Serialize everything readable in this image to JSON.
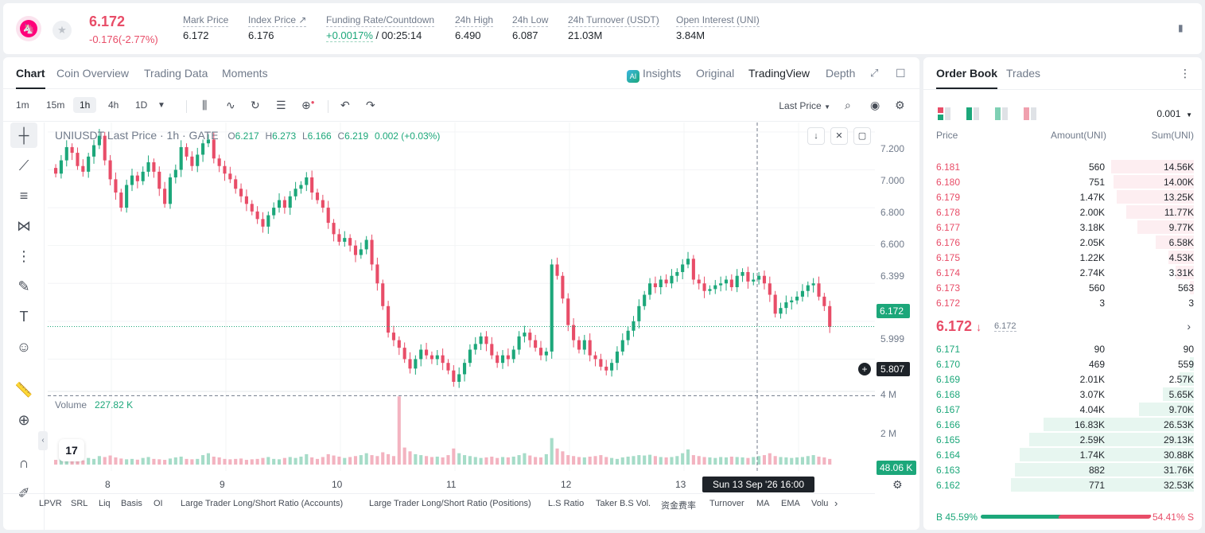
{
  "header": {
    "last_price": "6.172",
    "change": "-0.176(-2.77%)",
    "stats": [
      {
        "label": "Mark Price",
        "value": "6.172"
      },
      {
        "label": "Index Price ↗",
        "value": "6.176"
      },
      {
        "label": "Funding Rate/Countdown",
        "rate": "+0.0017%",
        "countdown": "/ 00:25:14"
      },
      {
        "label": "24h High",
        "value": "6.490"
      },
      {
        "label": "24h Low",
        "value": "6.087"
      },
      {
        "label": "24h Turnover (USDT)",
        "value": "21.03M"
      },
      {
        "label": "Open Interest (UNI)",
        "value": "3.84M"
      }
    ]
  },
  "tabs": {
    "chart": "Chart",
    "coin_overview": "Coin Overview",
    "trading_data": "Trading Data",
    "moments": "Moments",
    "ai_badge": "AI",
    "insights": "Insights",
    "original": "Original",
    "tradingview": "TradingView",
    "depth": "Depth"
  },
  "toolbar": {
    "timeframes": [
      "1m",
      "15m",
      "1h",
      "4h",
      "1D"
    ],
    "active_timeframe": "1h",
    "price_type": "Last Price"
  },
  "legend": {
    "symbol": "UNIUSDT Last Price · 1h · GATE",
    "o_label": "O",
    "o": "6.217",
    "h_label": "H",
    "h": "6.273",
    "l_label": "L",
    "l": "6.166",
    "c_label": "C",
    "c": "6.219",
    "chg": "0.002 (+0.03%)",
    "volume_label": "Volume",
    "volume_value": "227.82 K"
  },
  "price_axis": [
    "7.200",
    "7.000",
    "6.800",
    "6.600",
    "6.399",
    "5.999",
    "4 M",
    "2 M"
  ],
  "tags": {
    "current_price": "6.172",
    "crosshair_price": "5.807",
    "volume": "48.06 K",
    "date": "Sun 13 Sep '26   16:00"
  },
  "x_axis": [
    "8",
    "9",
    "10",
    "11",
    "12",
    "13"
  ],
  "indicators": [
    "LPVR",
    "SRL",
    "Liq",
    "Basis",
    "OI",
    "Large Trader Long/Short Ratio (Accounts)",
    "Large Trader Long/Short Ratio (Positions)",
    "L.S Ratio",
    "Taker B.S Vol.",
    "资金费率",
    "Turnover",
    "MA",
    "EMA",
    "Volu"
  ],
  "chart_data": {
    "type": "candlestick",
    "symbol": "UNIUSDT",
    "interval": "1h",
    "ylim": [
      5.8,
      7.25
    ],
    "colors": {
      "up": "#1ca77a",
      "down": "#e84d68"
    },
    "closes": [
      6.98,
      7.05,
      7.12,
      7.09,
      7.02,
      6.99,
      7.07,
      7.13,
      7.18,
      7.05,
      6.95,
      6.88,
      6.8,
      6.92,
      6.97,
      6.94,
      6.99,
      7.04,
      6.99,
      6.9,
      6.82,
      6.96,
      7.0,
      7.12,
      7.07,
      7.02,
      7.08,
      7.14,
      7.16,
      7.06,
      7.02,
      6.98,
      6.95,
      6.9,
      6.86,
      6.82,
      6.78,
      6.74,
      6.7,
      6.76,
      6.8,
      6.84,
      6.8,
      6.86,
      6.9,
      6.92,
      6.96,
      6.88,
      6.84,
      6.8,
      6.72,
      6.66,
      6.62,
      6.64,
      6.6,
      6.55,
      6.58,
      6.63,
      6.5,
      6.4,
      6.28,
      6.14,
      6.1,
      6.06,
      6.0,
      5.95,
      6.0,
      6.05,
      6.02,
      6.0,
      6.02,
      5.98,
      5.94,
      5.88,
      5.92,
      5.98,
      6.05,
      6.08,
      6.12,
      6.08,
      6.02,
      5.98,
      6.02,
      6.0,
      6.05,
      6.12,
      6.14,
      6.1,
      6.06,
      6.02,
      6.04,
      6.5,
      6.44,
      6.32,
      6.18,
      6.1,
      6.05,
      6.1,
      6.02,
      6.0,
      5.96,
      5.94,
      5.98,
      6.04,
      6.1,
      6.15,
      6.2,
      6.28,
      6.34,
      6.4,
      6.38,
      6.42,
      6.4,
      6.44,
      6.46,
      6.5,
      6.53,
      6.42,
      6.4,
      6.36,
      6.37,
      6.39,
      6.4,
      6.42,
      6.38,
      6.44,
      6.46,
      6.41,
      6.42,
      6.44,
      6.4,
      6.34,
      6.24,
      6.27,
      6.3,
      6.31,
      6.33,
      6.36,
      6.39,
      6.4,
      6.33,
      6.28,
      6.17
    ],
    "volumes": [
      0.25,
      0.32,
      0.4,
      0.3,
      0.28,
      0.22,
      0.35,
      0.3,
      0.45,
      0.4,
      0.48,
      0.38,
      0.32,
      0.28,
      0.3,
      0.26,
      0.35,
      0.4,
      0.3,
      0.28,
      0.25,
      0.32,
      0.38,
      0.42,
      0.3,
      0.28,
      0.3,
      0.5,
      0.6,
      0.42,
      0.38,
      0.3,
      0.28,
      0.3,
      0.32,
      0.25,
      0.28,
      0.3,
      0.35,
      0.4,
      0.3,
      0.28,
      0.35,
      0.4,
      0.35,
      0.42,
      0.55,
      0.38,
      0.3,
      0.4,
      0.55,
      0.48,
      0.42,
      0.35,
      0.4,
      0.45,
      0.5,
      0.6,
      0.5,
      0.45,
      0.65,
      0.55,
      0.45,
      3.6,
      0.9,
      0.7,
      0.55,
      0.5,
      0.45,
      0.4,
      0.42,
      0.38,
      0.5,
      0.85,
      0.6,
      0.5,
      0.45,
      0.4,
      0.35,
      0.38,
      0.42,
      0.35,
      0.4,
      0.38,
      0.42,
      0.5,
      0.6,
      0.48,
      0.4,
      0.38,
      0.55,
      1.4,
      0.85,
      0.7,
      0.5,
      0.45,
      0.4,
      0.38,
      0.42,
      0.45,
      0.5,
      0.4,
      0.35,
      0.3,
      0.38,
      0.42,
      0.45,
      0.5,
      0.48,
      0.52,
      0.45,
      0.4,
      0.38,
      0.4,
      0.45,
      0.6,
      0.8,
      0.5,
      0.45,
      0.4,
      0.38,
      0.35,
      0.4,
      0.38,
      0.42,
      0.4,
      0.38,
      0.35,
      0.4,
      0.45,
      0.5,
      0.6,
      0.45,
      0.4,
      0.38,
      0.35,
      0.38,
      0.4,
      0.45,
      0.5,
      0.42,
      0.38,
      0.3
    ]
  },
  "order_book": {
    "tab_order_book": "Order Book",
    "tab_trades": "Trades",
    "precision": "0.001",
    "head_price": "Price",
    "head_amount": "Amount(UNI)",
    "head_sum": "Sum(UNI)",
    "asks": [
      {
        "price": "6.181",
        "amount": "560",
        "sum": "14.56K",
        "depth": 0.45
      },
      {
        "price": "6.180",
        "amount": "751",
        "sum": "14.00K",
        "depth": 0.44
      },
      {
        "price": "6.179",
        "amount": "1.47K",
        "sum": "13.25K",
        "depth": 0.42
      },
      {
        "price": "6.178",
        "amount": "2.00K",
        "sum": "11.77K",
        "depth": 0.37
      },
      {
        "price": "6.177",
        "amount": "3.18K",
        "sum": "9.77K",
        "depth": 0.31
      },
      {
        "price": "6.176",
        "amount": "2.05K",
        "sum": "6.58K",
        "depth": 0.21
      },
      {
        "price": "6.175",
        "amount": "1.22K",
        "sum": "4.53K",
        "depth": 0.14
      },
      {
        "price": "6.174",
        "amount": "2.74K",
        "sum": "3.31K",
        "depth": 0.1
      },
      {
        "price": "6.173",
        "amount": "560",
        "sum": "563",
        "depth": 0.02
      },
      {
        "price": "6.172",
        "amount": "3",
        "sum": "3",
        "depth": 0.0
      }
    ],
    "last_price": "6.172",
    "last_arrow": "↓",
    "index_price": "6.172",
    "bids": [
      {
        "price": "6.171",
        "amount": "90",
        "sum": "90",
        "depth": 0.0
      },
      {
        "price": "6.170",
        "amount": "469",
        "sum": "559",
        "depth": 0.02
      },
      {
        "price": "6.169",
        "amount": "2.01K",
        "sum": "2.57K",
        "depth": 0.08
      },
      {
        "price": "6.168",
        "amount": "3.07K",
        "sum": "5.65K",
        "depth": 0.17
      },
      {
        "price": "6.167",
        "amount": "4.04K",
        "sum": "9.70K",
        "depth": 0.3
      },
      {
        "price": "6.166",
        "amount": "16.83K",
        "sum": "26.53K",
        "depth": 0.82
      },
      {
        "price": "6.165",
        "amount": "2.59K",
        "sum": "29.13K",
        "depth": 0.9
      },
      {
        "price": "6.164",
        "amount": "1.74K",
        "sum": "30.88K",
        "depth": 0.95
      },
      {
        "price": "6.163",
        "amount": "882",
        "sum": "31.76K",
        "depth": 0.98
      },
      {
        "price": "6.162",
        "amount": "771",
        "sum": "32.53K",
        "depth": 1.0
      }
    ],
    "buy_ratio": "B 45.59%",
    "sell_ratio": "54.41% S"
  }
}
